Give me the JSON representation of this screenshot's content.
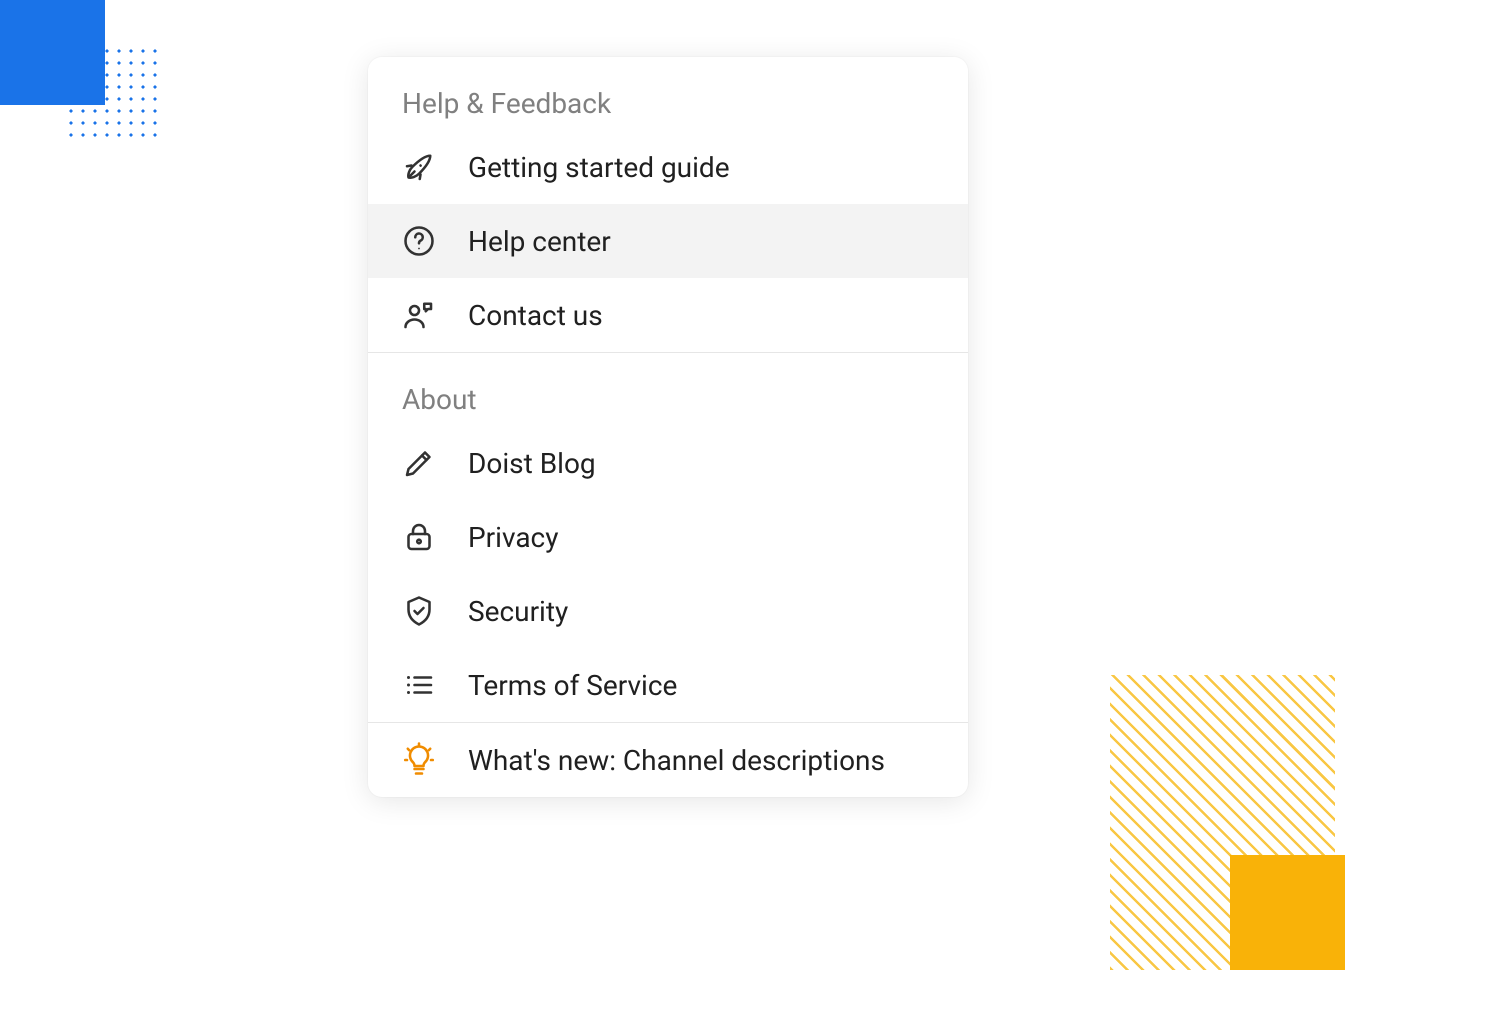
{
  "sections": [
    {
      "title": "Help & Feedback",
      "items": [
        {
          "id": "getting-started",
          "icon": "rocket-icon",
          "label": "Getting started guide",
          "highlight": false
        },
        {
          "id": "help-center",
          "icon": "help-icon",
          "label": "Help center",
          "highlight": true
        },
        {
          "id": "contact",
          "icon": "contact-icon",
          "label": "Contact us",
          "highlight": false
        }
      ]
    },
    {
      "title": "About",
      "items": [
        {
          "id": "blog",
          "icon": "pencil-icon",
          "label": "Doist Blog",
          "highlight": false
        },
        {
          "id": "privacy",
          "icon": "lock-icon",
          "label": "Privacy",
          "highlight": false
        },
        {
          "id": "security",
          "icon": "shield-icon",
          "label": "Security",
          "highlight": false
        },
        {
          "id": "terms",
          "icon": "list-icon",
          "label": "Terms of Service",
          "highlight": false
        }
      ]
    },
    {
      "title": null,
      "items": [
        {
          "id": "whats-new",
          "icon": "bulb-icon",
          "label": "What's new: Channel descriptions",
          "highlight": false,
          "accent": true
        }
      ]
    }
  ],
  "colors": {
    "accent": "#f08c00",
    "iconStroke": "#323232",
    "highlight": "#f3f3f3",
    "decoBlue": "#1a73e8",
    "decoYellow": "#f9b208"
  }
}
